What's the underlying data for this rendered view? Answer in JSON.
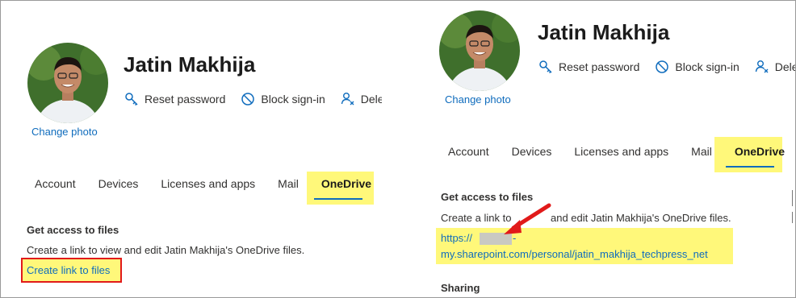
{
  "left": {
    "user_name": "Jatin Makhija",
    "change_photo": "Change photo",
    "actions": [
      {
        "label": "Reset password",
        "icon": "key-icon"
      },
      {
        "label": "Block sign-in",
        "icon": "block-icon"
      },
      {
        "label": "Delet",
        "icon": "delete-user-icon"
      }
    ],
    "tabs": [
      "Account",
      "Devices",
      "Licenses and apps",
      "Mail",
      "OneDrive"
    ],
    "active_tab": "OneDrive",
    "section_title": "Get access to files",
    "description": "Create a link to view and edit Jatin Makhija's OneDrive files.",
    "create_link": "Create link to files"
  },
  "right": {
    "user_name": "Jatin Makhija",
    "change_photo": "Change photo",
    "actions": [
      {
        "label": "Reset password",
        "icon": "key-icon"
      },
      {
        "label": "Block sign-in",
        "icon": "block-icon"
      },
      {
        "label": "Delete",
        "icon": "delete-user-icon"
      }
    ],
    "tabs": [
      "Account",
      "Devices",
      "Licenses and apps",
      "Mail",
      "OneDrive"
    ],
    "active_tab": "OneDrive",
    "section_title": "Get access to files",
    "description_start": "Create a link to",
    "description_end": "and edit Jatin Makhija's OneDrive files.",
    "url_line1_start": "https://",
    "url_line1_end": "-",
    "url_line2": "my.sharepoint.com/personal/jatin_makhija_techpress_net",
    "sharing_title": "Sharing"
  },
  "colors": {
    "highlight": "#fff87a",
    "link": "#0f6cbd",
    "annotation_red": "#e11a1a"
  }
}
